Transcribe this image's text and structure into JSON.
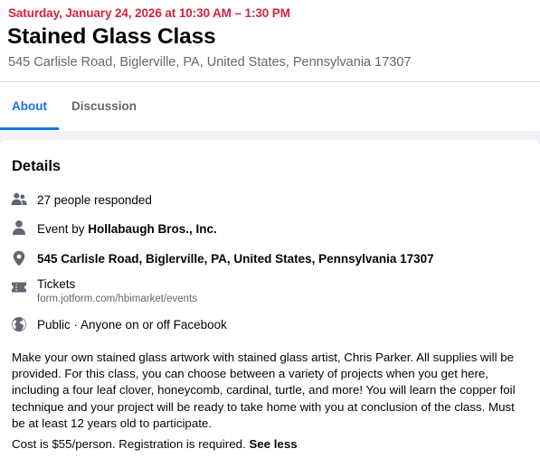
{
  "event": {
    "date": "Saturday, January 24, 2026 at 10:30 AM – 1:30 PM",
    "title": "Stained Glass Class",
    "location_header": "545 Carlisle Road, Biglerville, PA, United States, Pennsylvania 17307"
  },
  "tabs": [
    {
      "label": "About",
      "active": true
    },
    {
      "label": "Discussion",
      "active": false
    }
  ],
  "details": {
    "heading": "Details",
    "responded": "27 people responded",
    "event_by_prefix": "Event by ",
    "organizer": "Hollabaugh Bros., Inc.",
    "address": "545 Carlisle Road, Biglerville, PA, United States, Pennsylvania 17307",
    "tickets_label": "Tickets",
    "tickets_link": "form.jotform.com/hbimarket/events",
    "privacy": "Public · Anyone on or off Facebook",
    "description": "Make your own stained glass artwork with stained glass artist, Chris Parker. All supplies will be provided. For this class, you can choose between a variety of projects when you get here, including a four leaf clover, honeycomb, cardinal, turtle, and more! You will learn the copper foil technique and your project will be ready to take home with you at conclusion of the class. Must be at least 12 years old to participate.",
    "cost_text": "Cost is $55/person. Registration is required. ",
    "see_less": "See less"
  },
  "icons": {
    "responded": "people-icon",
    "organizer": "person-icon",
    "address": "location-pin-icon",
    "tickets": "ticket-icon",
    "privacy": "globe-icon"
  },
  "colors": {
    "date_red": "#d1253f",
    "accent_blue": "#1b74e4",
    "secondary_text": "#65676b",
    "icon_gray": "#606770"
  }
}
